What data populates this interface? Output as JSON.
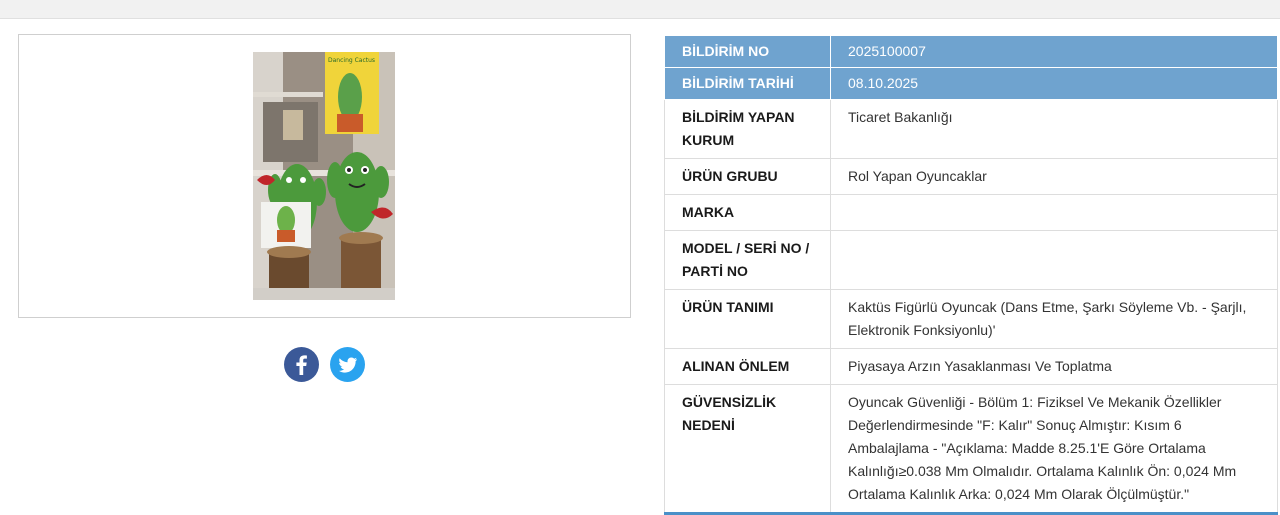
{
  "social": {
    "facebook_icon": "facebook-icon",
    "twitter_icon": "twitter-icon",
    "facebook_color": "#3b5998",
    "twitter_color": "#2aa3ef"
  },
  "photo": {
    "package_text": "Dancing Cactus"
  },
  "colors": {
    "header_row_bg": "#6fa3cf",
    "table_bottom_border": "#4a90c8"
  },
  "details": {
    "bildirim_no": {
      "label": "BİLDİRİM NO",
      "value": "2025100007"
    },
    "bildirim_tarihi": {
      "label": "BİLDİRİM TARİHİ",
      "value": "08.10.2025"
    },
    "kurum": {
      "label": "BİLDİRİM YAPAN KURUM",
      "value": "Ticaret Bakanlığı"
    },
    "urun_grubu": {
      "label": "ÜRÜN GRUBU",
      "value": "Rol Yapan Oyuncaklar"
    },
    "marka": {
      "label": "MARKA",
      "value": ""
    },
    "model": {
      "label": "MODEL / SERİ NO / PARTİ NO",
      "value": ""
    },
    "urun_tanimi": {
      "label": "ÜRÜN TANIMI",
      "value": "Kaktüs Figürlü Oyuncak (Dans Etme, Şarkı Söyleme Vb. - Şarjlı, Elektronik Fonksiyonlu)'"
    },
    "onlem": {
      "label": "ALINAN ÖNLEM",
      "value": "Piyasaya Arzın Yasaklanması Ve Toplatma"
    },
    "neden": {
      "label": "GÜVENSİZLİK NEDENİ",
      "value": "Oyuncak Güvenliği - Bölüm 1: Fiziksel Ve Mekanik Özellikler Değerlendirmesinde \"F: Kalır\" Sonuç Almıştır: Kısım 6 Ambalajlama - \"Açıklama: Madde 8.25.1'E Göre Ortalama Kalınlığı≥0.038 Mm Olmalıdır. Ortalama Kalınlık Ön: 0,024 Mm Ortalama Kalınlık Arka: 0,024 Mm Olarak Ölçülmüştür.\""
    }
  }
}
